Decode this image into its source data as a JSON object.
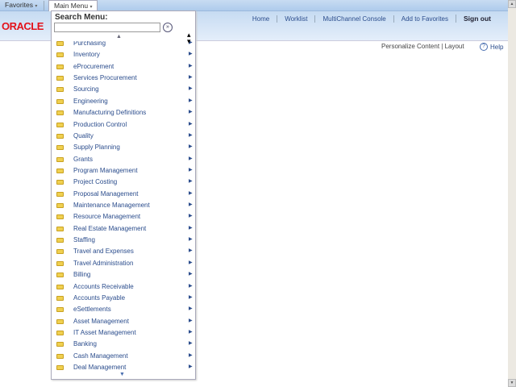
{
  "navbar": {
    "favorites": "Favorites",
    "main_menu": "Main Menu",
    "caret": "▾"
  },
  "header": {
    "logo": "ORACLE",
    "links": [
      "Home",
      "Worklist",
      "MultiChannel Console",
      "Add to Favorites",
      "Sign out"
    ]
  },
  "page": {
    "personalize": "Personalize Content | Layout",
    "help": "Help",
    "help_icon": "?"
  },
  "menu": {
    "search_label": "Search Menu:",
    "search_value": "",
    "go_icon": "»",
    "items": [
      "Purchasing",
      "Inventory",
      "eProcurement",
      "Services Procurement",
      "Sourcing",
      "Engineering",
      "Manufacturing Definitions",
      "Production Control",
      "Quality",
      "Supply Planning",
      "Grants",
      "Program Management",
      "Project Costing",
      "Proposal Management",
      "Maintenance Management",
      "Resource Management",
      "Real Estate Management",
      "Staffing",
      "Travel and Expenses",
      "Travel Administration",
      "Billing",
      "Accounts Receivable",
      "Accounts Payable",
      "eSettlements",
      "Asset Management",
      "IT Asset Management",
      "Banking",
      "Cash Management",
      "Deal Management"
    ]
  }
}
